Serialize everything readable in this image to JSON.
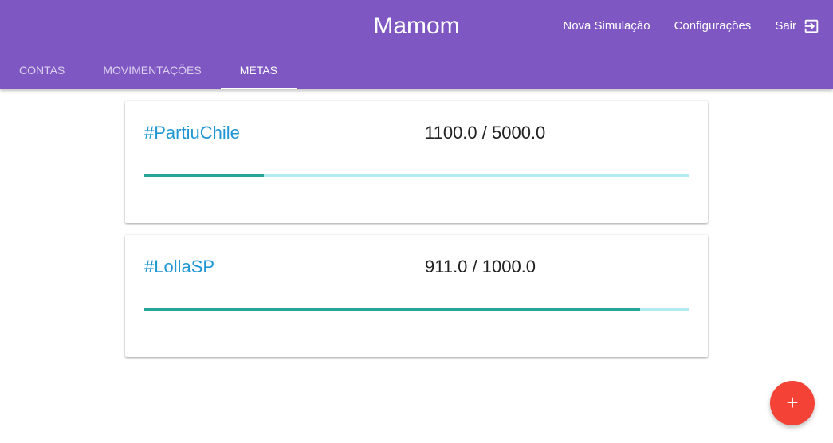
{
  "app": {
    "title": "Mamom"
  },
  "top_actions": {
    "new_simulation": "Nova Simulação",
    "settings": "Configurações",
    "logout": "Sair",
    "logout_icon": "exit-to-app-icon"
  },
  "tabs": [
    {
      "label": "CONTAS",
      "active": false
    },
    {
      "label": "MOVIMENTAÇÕES",
      "active": false
    },
    {
      "label": "METAS",
      "active": true
    }
  ],
  "goals": [
    {
      "name": "#PartiuChile",
      "amount_text": "1100.0 / 5000.0",
      "current": 1100.0,
      "target": 5000.0
    },
    {
      "name": "#LollaSP",
      "amount_text": "911.0 / 1000.0",
      "current": 911.0,
      "target": 1000.0
    }
  ],
  "fab": {
    "label": "+",
    "icon": "plus-icon"
  },
  "colors": {
    "primary": "#7e57c2",
    "accent": "#f44336",
    "link": "#1f97d4",
    "progress_fill": "#26a69a",
    "progress_track": "#b2ebf2"
  }
}
